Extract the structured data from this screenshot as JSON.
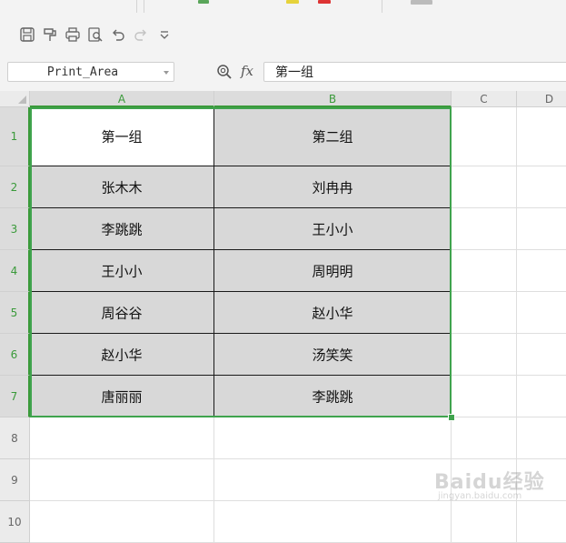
{
  "name_box": {
    "value": "Print_Area"
  },
  "formula_bar": {
    "fx_label": "fx",
    "value": "第一组"
  },
  "columns": [
    "A",
    "B",
    "C",
    "D"
  ],
  "rows": [
    "1",
    "2",
    "3",
    "4",
    "5",
    "6",
    "7",
    "8",
    "9",
    "10"
  ],
  "table": {
    "header": [
      "第一组",
      "第二组"
    ],
    "data": [
      [
        "张木木",
        "刘冉冉"
      ],
      [
        "李跳跳",
        "王小小"
      ],
      [
        "王小小",
        "周明明"
      ],
      [
        "周谷谷",
        "赵小华"
      ],
      [
        "赵小华",
        "汤笑笑"
      ],
      [
        "唐丽丽",
        "李跳跳"
      ]
    ]
  },
  "selection": {
    "range": "A1:B7",
    "active_cell": "A1",
    "color": "#3fa34d"
  },
  "watermark": {
    "text": "Baidu经验",
    "url": "jingyan.baidu.com"
  },
  "toolbar_icons": [
    "save-icon",
    "format-painter-icon",
    "print-icon",
    "print-preview-icon",
    "undo-icon",
    "redo-icon",
    "customize-toolbar-icon"
  ]
}
